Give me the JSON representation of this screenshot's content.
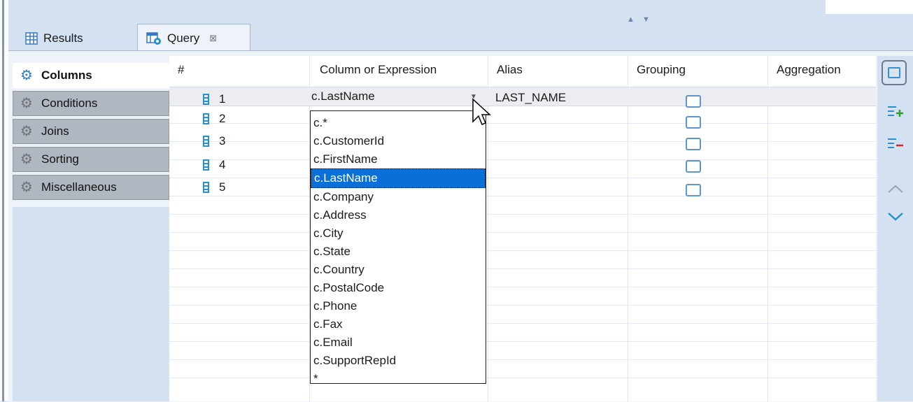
{
  "tabs": [
    {
      "label": "Results",
      "icon": "table-grid-icon",
      "active": false
    },
    {
      "label": "Query",
      "icon": "query-builder-icon",
      "active": true,
      "close": "⊠"
    }
  ],
  "sort_arrows": "▲ ▼",
  "nav": [
    {
      "label": "Columns",
      "active": true
    },
    {
      "label": "Conditions",
      "active": false
    },
    {
      "label": "Joins",
      "active": false
    },
    {
      "label": "Sorting",
      "active": false
    },
    {
      "label": "Miscellaneous",
      "active": false
    }
  ],
  "grid": {
    "headers": {
      "num": "#",
      "column": "Column or Expression",
      "alias": "Alias",
      "grouping": "Grouping",
      "aggregation": "Aggregation"
    },
    "rows": [
      {
        "n": "1",
        "column": "c.LastName",
        "alias": "LAST_NAME",
        "grouping": false
      },
      {
        "n": "2",
        "column": "",
        "alias": "",
        "grouping": false
      },
      {
        "n": "3",
        "column": "",
        "alias": "",
        "grouping": false
      },
      {
        "n": "4",
        "column": "",
        "alias": "",
        "grouping": false
      },
      {
        "n": "5",
        "column": "",
        "alias": "",
        "grouping": false
      }
    ]
  },
  "dropdown": {
    "selected": "c.LastName",
    "options": [
      "c.*",
      "c.CustomerId",
      "c.FirstName",
      "c.LastName",
      "c.Company",
      "c.Address",
      "c.City",
      "c.State",
      "c.Country",
      "c.PostalCode",
      "c.Phone",
      "c.Fax",
      "c.Email",
      "c.SupportRepId",
      "*"
    ]
  },
  "toolbar": [
    "column-view-icon",
    "add-row-icon",
    "remove-row-icon",
    "move-up-icon",
    "move-down-icon"
  ],
  "colors": {
    "accent": "#2a8fd0",
    "selection": "#0a6fd6",
    "panel_bg": "#d4e1f0",
    "add_green": "#2ca02c",
    "remove_red": "#d9262c"
  }
}
